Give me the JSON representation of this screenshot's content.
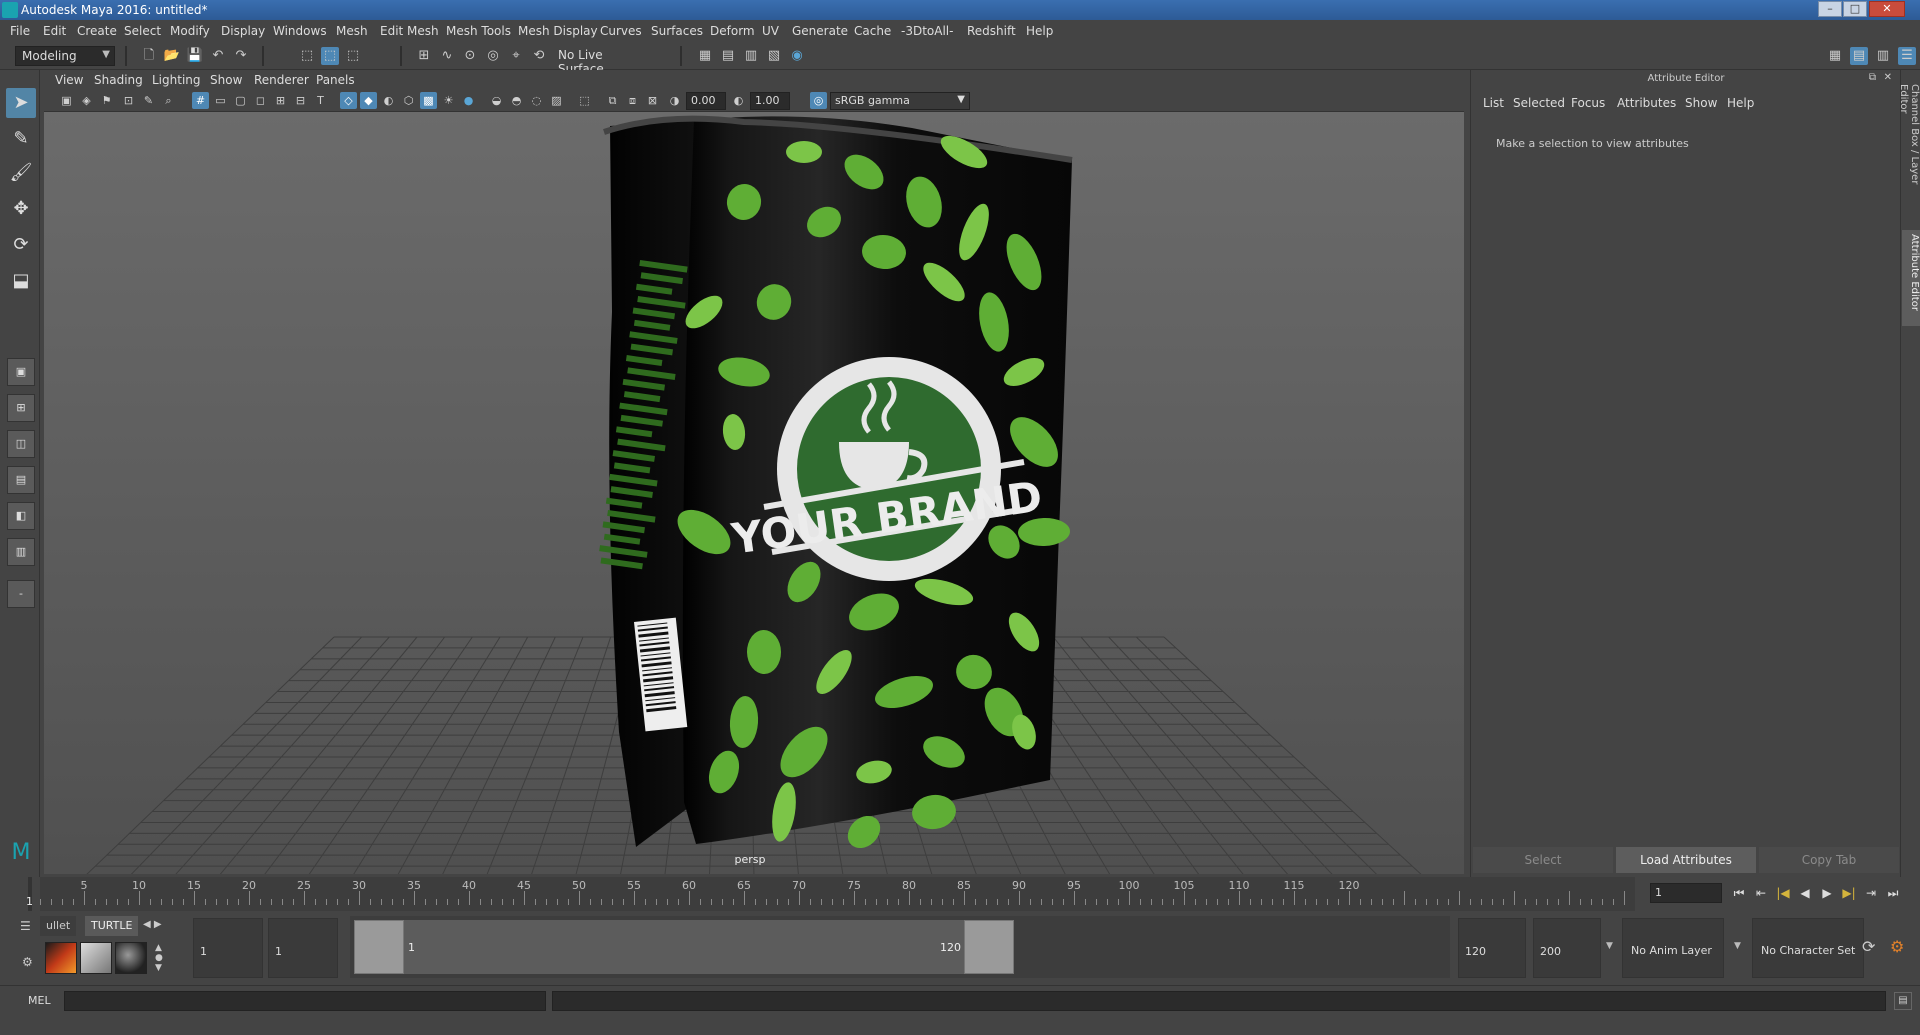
{
  "window": {
    "title": "Autodesk Maya 2016: untitled*",
    "controls": [
      "–",
      "□",
      "✕"
    ]
  },
  "menubar": [
    "File",
    "Edit",
    "Create",
    "Select",
    "Modify",
    "Display",
    "Windows",
    "Mesh",
    "Edit Mesh",
    "Mesh Tools",
    "Mesh Display",
    "Curves",
    "Surfaces",
    "Deform",
    "UV",
    "Generate",
    "Cache",
    "-3DtoAll-",
    "Redshift",
    "Help"
  ],
  "statusline": {
    "menuset": "Modeling",
    "live_surface": "No Live Surface"
  },
  "panel_menu": [
    "View",
    "Shading",
    "Lighting",
    "Show",
    "Renderer",
    "Panels"
  ],
  "viewport_toolbar": {
    "exposure": "0.00",
    "gamma": "1.00",
    "color_space": "sRGB gamma"
  },
  "viewport": {
    "camera": "persp",
    "product": {
      "brand_text": "YOUR BRAND",
      "bag_color": "#0f0f0f",
      "leaf_color": "#5fae35",
      "badge_color": "#2f6b2f"
    }
  },
  "attribute_editor": {
    "header": "Attribute Editor",
    "menu": [
      "List",
      "Selected",
      "Focus",
      "Attributes",
      "Show",
      "Help"
    ],
    "message": "Make a selection to view attributes",
    "buttons": [
      "Select",
      "Load Attributes",
      "Copy Tab"
    ]
  },
  "side_tabs": [
    "Channel Box / Layer Editor",
    "Attribute Editor"
  ],
  "time_slider": {
    "tick_labels": [
      "5",
      "10",
      "15",
      "20",
      "25",
      "30",
      "35",
      "40",
      "45",
      "50",
      "55",
      "60",
      "65",
      "70",
      "75",
      "80",
      "85",
      "90",
      "95",
      "100",
      "105",
      "110",
      "115",
      "120"
    ],
    "current_frame_label": "1",
    "current_frame": "1",
    "playback_buttons": [
      "⏮",
      "⇤",
      "|◀",
      "◀",
      "▶",
      "▶|",
      "⇥",
      "⏭"
    ]
  },
  "range_slider": {
    "shelf_tabs": [
      "ullet",
      "TURTLE"
    ],
    "start_time": "1",
    "playback_start": "1",
    "range_start_label": "1",
    "range_end_label": "120",
    "playback_end": "120",
    "end_time": "200",
    "anim_layer": "No Anim Layer",
    "character_set": "No Character Set"
  },
  "command_line": {
    "language": "MEL"
  }
}
